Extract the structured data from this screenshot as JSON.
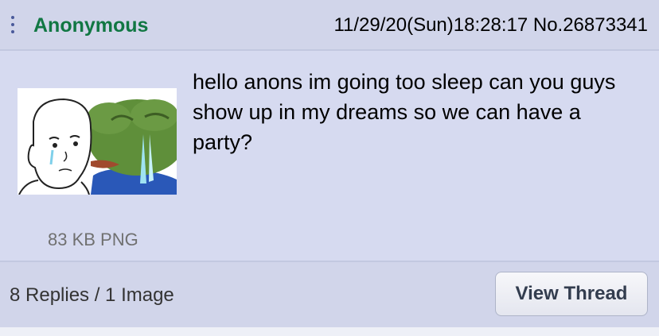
{
  "post": {
    "name": "Anonymous",
    "datetime": "11/29/20(Sun)18:28:17",
    "number": "No.26873341",
    "message": "hello anons im going too sleep can you guys show up in my dreams so we can have a party?",
    "file_info": "83 KB PNG",
    "thumbnail_icon": "sad-wojak-pepe-hug-image"
  },
  "footer": {
    "replies": "8 Replies / 1 Image",
    "view_label": "View Thread"
  },
  "colors": {
    "name": "#117743",
    "card": "#d6daf0",
    "header": "#d1d5ea"
  }
}
